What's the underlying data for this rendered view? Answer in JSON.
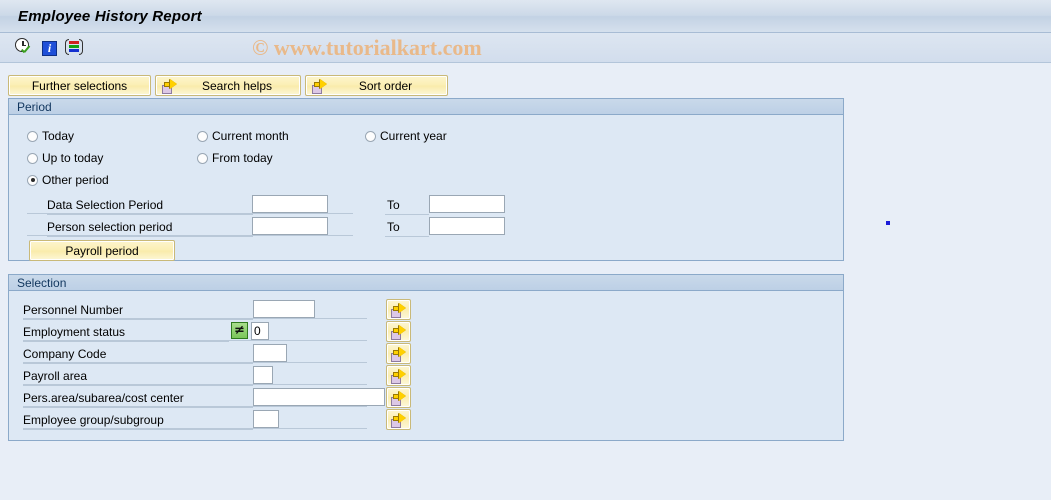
{
  "window": {
    "title": "Employee History Report"
  },
  "toolbar": {
    "icons": [
      {
        "name": "execute-clock-icon",
        "glyph": "clock-check"
      },
      {
        "name": "information-icon",
        "glyph": "i"
      },
      {
        "name": "selection-list-icon",
        "glyph": "bars"
      }
    ],
    "watermark": "© www.tutorialkart.com"
  },
  "buttonbar": {
    "further_selections": "Further selections",
    "search_helps": "Search helps",
    "sort_order": "Sort order"
  },
  "period": {
    "header": "Period",
    "radios": [
      {
        "label": "Today",
        "checked": false
      },
      {
        "label": "Current month",
        "checked": false
      },
      {
        "label": "Current year",
        "checked": false
      },
      {
        "label": "Up to today",
        "checked": false
      },
      {
        "label": "From today",
        "checked": false
      },
      {
        "label": "Other period",
        "checked": true
      }
    ],
    "rows": [
      {
        "label": "Data Selection Period",
        "value": "",
        "to_label": "To",
        "to_value": ""
      },
      {
        "label": "Person selection period",
        "value": "",
        "to_label": "To",
        "to_value": ""
      }
    ],
    "payroll_period_button": "Payroll period"
  },
  "selection": {
    "header": "Selection",
    "rows": [
      {
        "label": "Personnel Number",
        "value": "",
        "operator": ""
      },
      {
        "label": "Employment status",
        "value": "0",
        "operator": "≠"
      },
      {
        "label": "Company Code",
        "value": "",
        "operator": ""
      },
      {
        "label": "Payroll area",
        "value": "",
        "operator": ""
      },
      {
        "label": "Pers.area/subarea/cost center",
        "value": "",
        "operator": ""
      },
      {
        "label": "Employee group/subgroup",
        "value": "",
        "operator": ""
      }
    ],
    "multi_select_button_title": "Multiple selection"
  },
  "colors": {
    "page_background": "#e8eef7",
    "panel_background": "#dde8f4",
    "panel_border": "#8ba9c9",
    "button_yellow": "#fbefb4",
    "watermark": "#e9b98a",
    "operator_green": "#7ac65a"
  }
}
